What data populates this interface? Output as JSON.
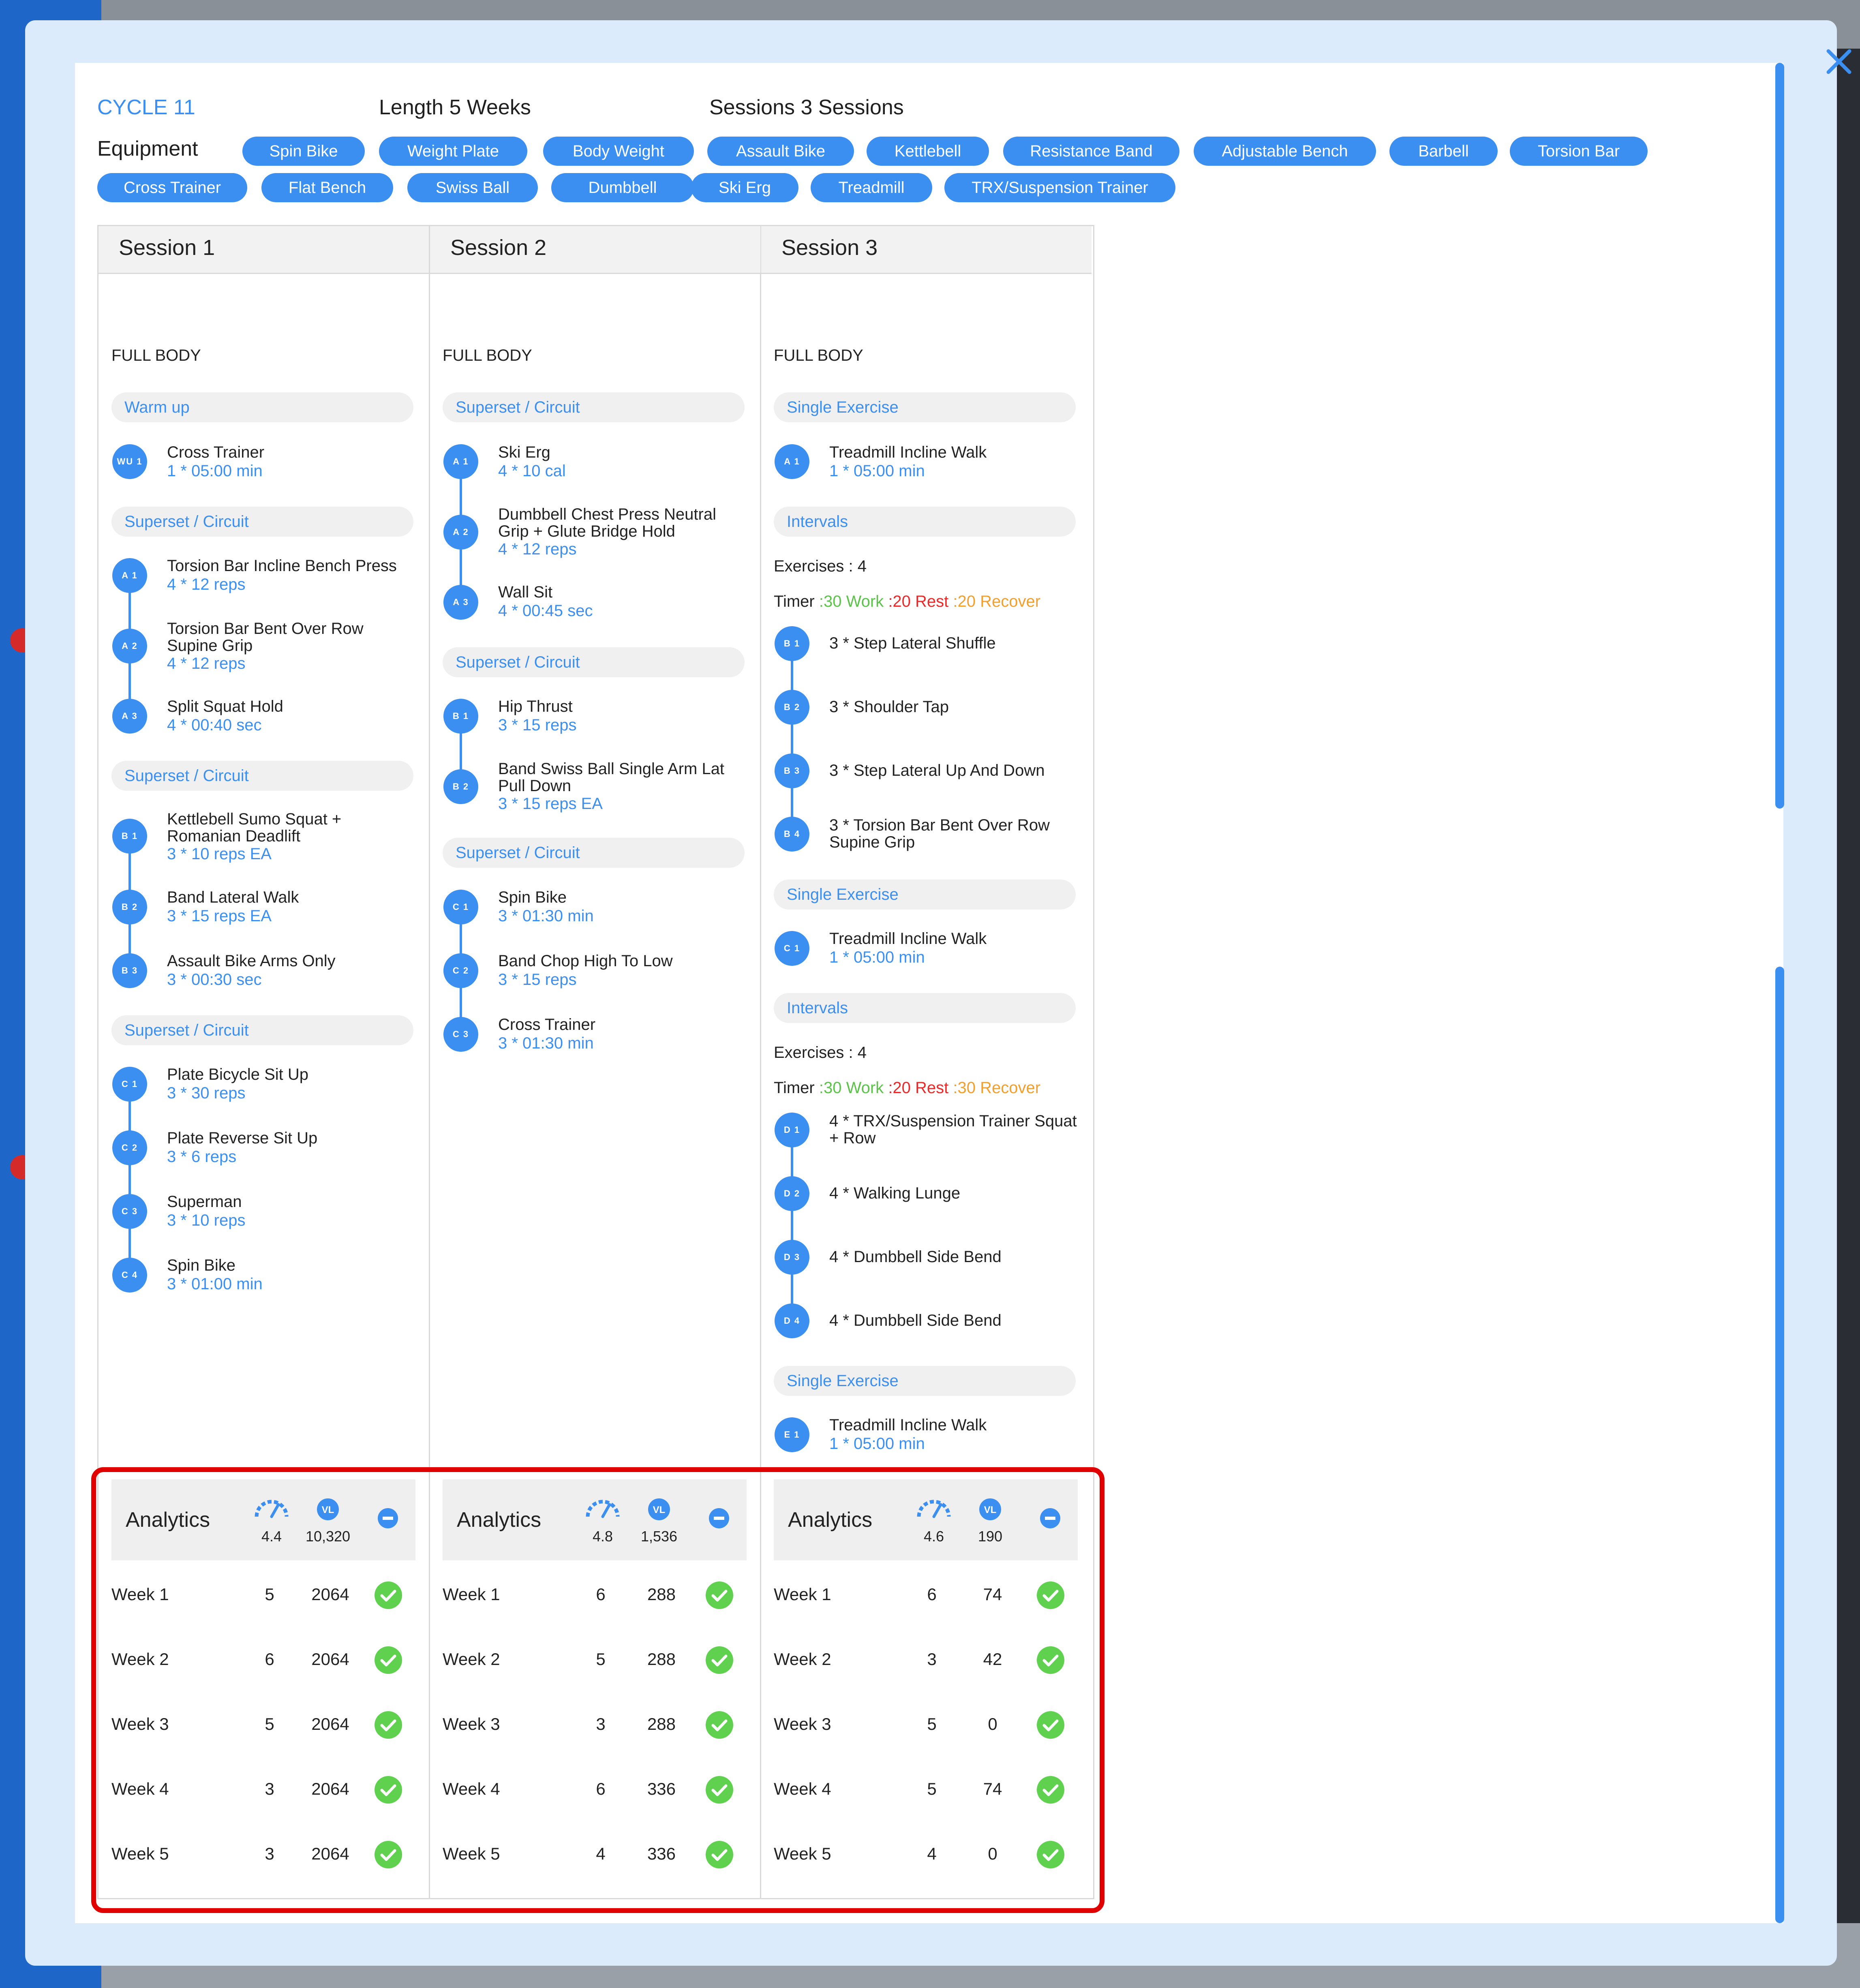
{
  "header": {
    "cycle": "CYCLE 11",
    "length": "Length 5 Weeks",
    "sessions": "Sessions 3 Sessions",
    "equipment_label": "Equipment"
  },
  "equipment": [
    "Spin Bike",
    "Weight Plate",
    "Body Weight",
    "Assault Bike",
    "Kettlebell",
    "Resistance Band",
    "Adjustable Bench",
    "Barbell",
    "Torsion Bar",
    "Cross Trainer",
    "Flat Bench",
    "Swiss Ball",
    "Dumbbell",
    "Ski Erg",
    "Treadmill",
    "TRX/Suspension Trainer"
  ],
  "sessions": [
    {
      "title": "Session 1",
      "type": "FULL BODY",
      "groups": [
        "Warm up",
        "Superset / Circuit",
        "Superset / Circuit",
        "Superset / Circuit"
      ],
      "exercises": [
        {
          "code": "WU 1",
          "name": "Cross Trainer",
          "value": "1 * 05:00 min"
        },
        {
          "code": "A 1",
          "name": "Torsion Bar Incline Bench Press",
          "value": "4 * 12 reps"
        },
        {
          "code": "A 2",
          "name": "Torsion Bar Bent Over Row Supine Grip",
          "value": "4 * 12 reps"
        },
        {
          "code": "A 3",
          "name": "Split Squat Hold",
          "value": "4 * 00:40 sec"
        },
        {
          "code": "B 1",
          "name": "Kettlebell Sumo Squat + Romanian Deadlift",
          "value": "3 * 10 reps EA"
        },
        {
          "code": "B 2",
          "name": "Band Lateral Walk",
          "value": "3 * 15 reps EA"
        },
        {
          "code": "B 3",
          "name": "Assault Bike Arms Only",
          "value": "3 * 00:30 sec"
        },
        {
          "code": "C 1",
          "name": "Plate Bicycle Sit Up",
          "value": "3 * 30 reps"
        },
        {
          "code": "C 2",
          "name": "Plate Reverse Sit Up",
          "value": "3 * 6 reps"
        },
        {
          "code": "C 3",
          "name": "Superman",
          "value": "3 * 10 reps"
        },
        {
          "code": "C 4",
          "name": "Spin Bike",
          "value": "3 * 01:00 min"
        }
      ],
      "analytics": {
        "label": "Analytics",
        "intensity": "4.4",
        "volume": "10,320"
      },
      "weeks": [
        {
          "week": "Week 1",
          "a": "5",
          "b": "2064"
        },
        {
          "week": "Week 2",
          "a": "6",
          "b": "2064"
        },
        {
          "week": "Week 3",
          "a": "5",
          "b": "2064"
        },
        {
          "week": "Week 4",
          "a": "3",
          "b": "2064"
        },
        {
          "week": "Week 5",
          "a": "3",
          "b": "2064"
        }
      ]
    },
    {
      "title": "Session 2",
      "type": "FULL BODY",
      "groups": [
        "Superset / Circuit",
        "Superset / Circuit",
        "Superset / Circuit"
      ],
      "exercises": [
        {
          "code": "A 1",
          "name": "Ski Erg",
          "value": "4 * 10 cal"
        },
        {
          "code": "A 2",
          "name": "Dumbbell Chest Press Neutral Grip + Glute Bridge Hold",
          "value": "4 * 12 reps"
        },
        {
          "code": "A 3",
          "name": "Wall Sit",
          "value": "4 * 00:45 sec"
        },
        {
          "code": "B 1",
          "name": "Hip Thrust",
          "value": "3 * 15 reps"
        },
        {
          "code": "B 2",
          "name": "Band Swiss Ball Single Arm Lat Pull Down",
          "value": "3 * 15 reps EA"
        },
        {
          "code": "C 1",
          "name": "Spin Bike",
          "value": "3 * 01:30 min"
        },
        {
          "code": "C 2",
          "name": "Band Chop High To Low",
          "value": "3 * 15 reps"
        },
        {
          "code": "C 3",
          "name": "Cross Trainer",
          "value": "3 * 01:30 min"
        }
      ],
      "analytics": {
        "label": "Analytics",
        "intensity": "4.8",
        "volume": "1,536"
      },
      "weeks": [
        {
          "week": "Week 1",
          "a": "6",
          "b": "288"
        },
        {
          "week": "Week 2",
          "a": "5",
          "b": "288"
        },
        {
          "week": "Week 3",
          "a": "3",
          "b": "288"
        },
        {
          "week": "Week 4",
          "a": "6",
          "b": "336"
        },
        {
          "week": "Week 5",
          "a": "4",
          "b": "336"
        }
      ]
    },
    {
      "title": "Session 3",
      "type": "FULL BODY",
      "groups": [
        "Single Exercise",
        "Intervals",
        "Single Exercise",
        "Intervals",
        "Single Exercise"
      ],
      "exercises": [
        {
          "code": "A 1",
          "name": "Treadmill Incline Walk",
          "value": "1 * 05:00 min"
        },
        {
          "code": "B 1",
          "name": "3 * Step Lateral Shuffle",
          "value": ""
        },
        {
          "code": "B 2",
          "name": "3 * Shoulder Tap",
          "value": ""
        },
        {
          "code": "B 3",
          "name": "3 * Step Lateral Up And Down",
          "value": ""
        },
        {
          "code": "B 4",
          "name": "3 * Torsion Bar Bent Over Row Supine Grip",
          "value": ""
        },
        {
          "code": "C 1",
          "name": "Treadmill Incline Walk",
          "value": "1 * 05:00 min"
        },
        {
          "code": "D 1",
          "name": "4 * TRX/Suspension Trainer Squat + Row",
          "value": ""
        },
        {
          "code": "D 2",
          "name": "4 * Walking Lunge",
          "value": ""
        },
        {
          "code": "D 3",
          "name": "4 * Dumbbell Side Bend",
          "value": ""
        },
        {
          "code": "D 4",
          "name": "4 * Dumbbell Side Bend",
          "value": ""
        },
        {
          "code": "E 1",
          "name": "Treadmill Incline Walk",
          "value": "1 * 05:00 min"
        }
      ],
      "intervals": [
        {
          "exercises": "Exercises : 4",
          "timer": "Timer",
          "work": ":30 Work",
          "rest": ":20 Rest",
          "recover": ":20 Recover"
        },
        {
          "exercises": "Exercises : 4",
          "timer": "Timer",
          "work": ":30 Work",
          "rest": ":20 Rest",
          "recover": ":30 Recover"
        }
      ],
      "analytics": {
        "label": "Analytics",
        "intensity": "4.6",
        "volume": "190"
      },
      "weeks": [
        {
          "week": "Week 1",
          "a": "6",
          "b": "74"
        },
        {
          "week": "Week 2",
          "a": "3",
          "b": "42"
        },
        {
          "week": "Week 3",
          "a": "5",
          "b": "0"
        },
        {
          "week": "Week 4",
          "a": "5",
          "b": "74"
        },
        {
          "week": "Week 5",
          "a": "4",
          "b": "0"
        }
      ]
    }
  ],
  "colors": {
    "accent": "#3b8ff0",
    "work": "#5cc24a",
    "rest": "#e82a2a",
    "recover": "#f0a030",
    "highlight": "#e00000"
  },
  "icons": [
    "close-icon",
    "gauge-icon",
    "vl-icon",
    "minus-icon",
    "check-icon"
  ]
}
